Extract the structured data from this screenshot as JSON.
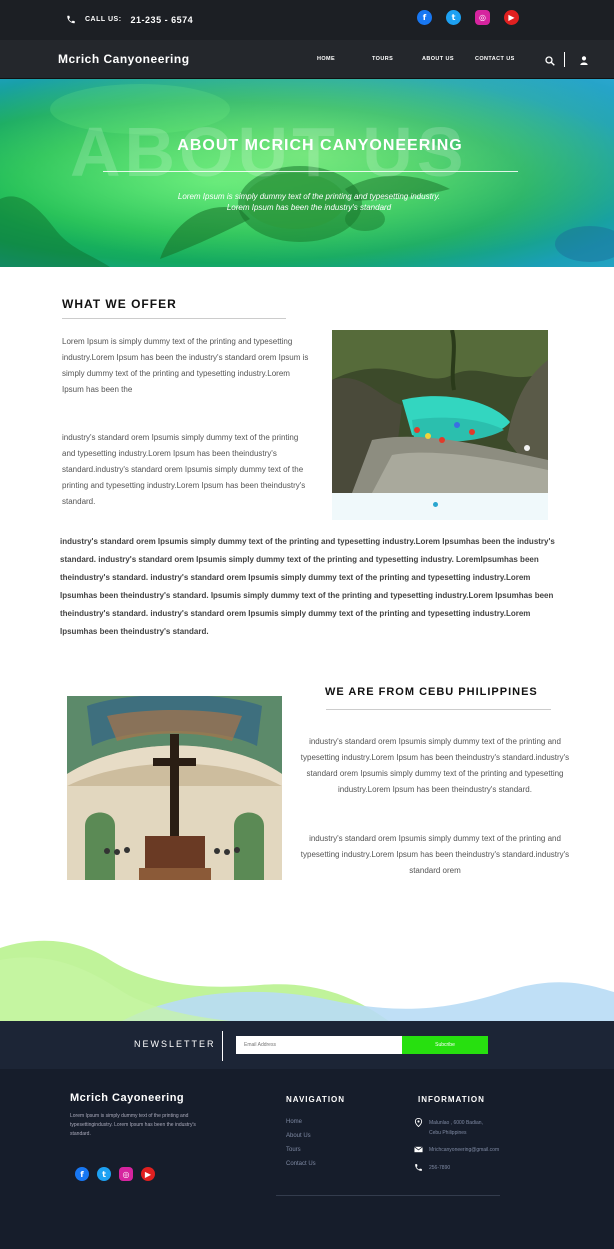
{
  "topbar": {
    "call_label": "CALL US:",
    "phone": "21-235 - 6574",
    "socials": [
      {
        "name": "facebook-icon",
        "glyph": "f",
        "color": "#1877f2"
      },
      {
        "name": "twitter-icon",
        "glyph": "t",
        "color": "#1da1f2"
      },
      {
        "name": "instagram-icon",
        "glyph": "◎",
        "color": "#d6249f"
      },
      {
        "name": "youtube-icon",
        "glyph": "▶",
        "color": "#e02020"
      }
    ]
  },
  "nav": {
    "brand": "Mcrich Canyoneering",
    "links": [
      "HOME",
      "TOURS",
      "ABOUT US",
      "CONTACT US"
    ]
  },
  "hero": {
    "bg_text": "ABOUT US",
    "title": "ABOUT MCRICH CANYONEERING",
    "subtitle_line1": "Lorem Ipsum is simply dummy text of the printing and typesetting industry.",
    "subtitle_line2": "Lorem Ipsum has been the industry's standard"
  },
  "offer": {
    "heading": "WHAT WE OFFER",
    "para1": "Lorem Ipsum is simply dummy text of the printing and typesetting industry.Lorem Ipsum has been the industry's standard orem Ipsum is simply dummy text of the printing and typesetting industry.Lorem Ipsum has been the",
    "para2": "industry's standard orem Ipsumis simply dummy text of the printing and typesetting industry.Lorem Ipsum has been theindustry's standard.industry's standard orem Ipsumis simply dummy text of the printing and typesetting industry.Lorem Ipsum has been theindustry's standard.",
    "wide": "industry's standard orem Ipsumis simply dummy text of the printing and typesetting industry.Lorem Ipsumhas been the industry's standard. industry's standard orem Ipsumis simply dummy text of the printing and typesetting industry. LoremIpsumhas been theindustry's standard. industry's standard orem Ipsumis simply dummy text of the printing and typesetting industry.Lorem Ipsumhas been theindustry's standard. Ipsumis simply dummy text of the printing and typesetting industry.Lorem Ipsumhas been theindustry's standard. industry's standard orem Ipsumis simply dummy text of the printing and typesetting industry.Lorem Ipsumhas been theindustry's standard."
  },
  "cebu": {
    "heading": "WE ARE FROM CEBU PHILIPPINES",
    "para1": "industry's standard orem Ipsumis simply dummy text of the printing and typesetting industry.Lorem Ipsum has been theindustry's standard.industry's standard orem Ipsumis simply dummy text of the printing and typesetting industry.Lorem Ipsum has been theindustry's standard.",
    "para2": "industry's standard orem Ipsumis simply dummy text of the printing and typesetting industry.Lorem Ipsum has been theindustry's standard.industry's standard orem"
  },
  "newsletter": {
    "label": "NEWSLETTER",
    "placeholder": "Email Address",
    "button": "Subcribe"
  },
  "footer": {
    "brand": "Mcrich Cayoneering",
    "desc": "Lorem Ipsum is simply dummy text of the printing and typesettingindustry. Lorem Ipsum has been the industry's standard.",
    "nav_heading": "NAVIGATION",
    "nav_links": [
      "Home",
      "About Us",
      "Tours",
      "Contact Us"
    ],
    "info_heading": "INFORMATION",
    "address_line1": "Malunlao , 6000 Badian,",
    "address_line2": "Cebu Philippines",
    "email": "Mrichcanyoneering@gmail.com",
    "phone": "256-7890"
  },
  "colors": {
    "topbar_bg": "#1c1f24",
    "accent_green": "#27e00f",
    "footer_bg": "#161d2b",
    "hero_teal": "#1fbf55"
  }
}
